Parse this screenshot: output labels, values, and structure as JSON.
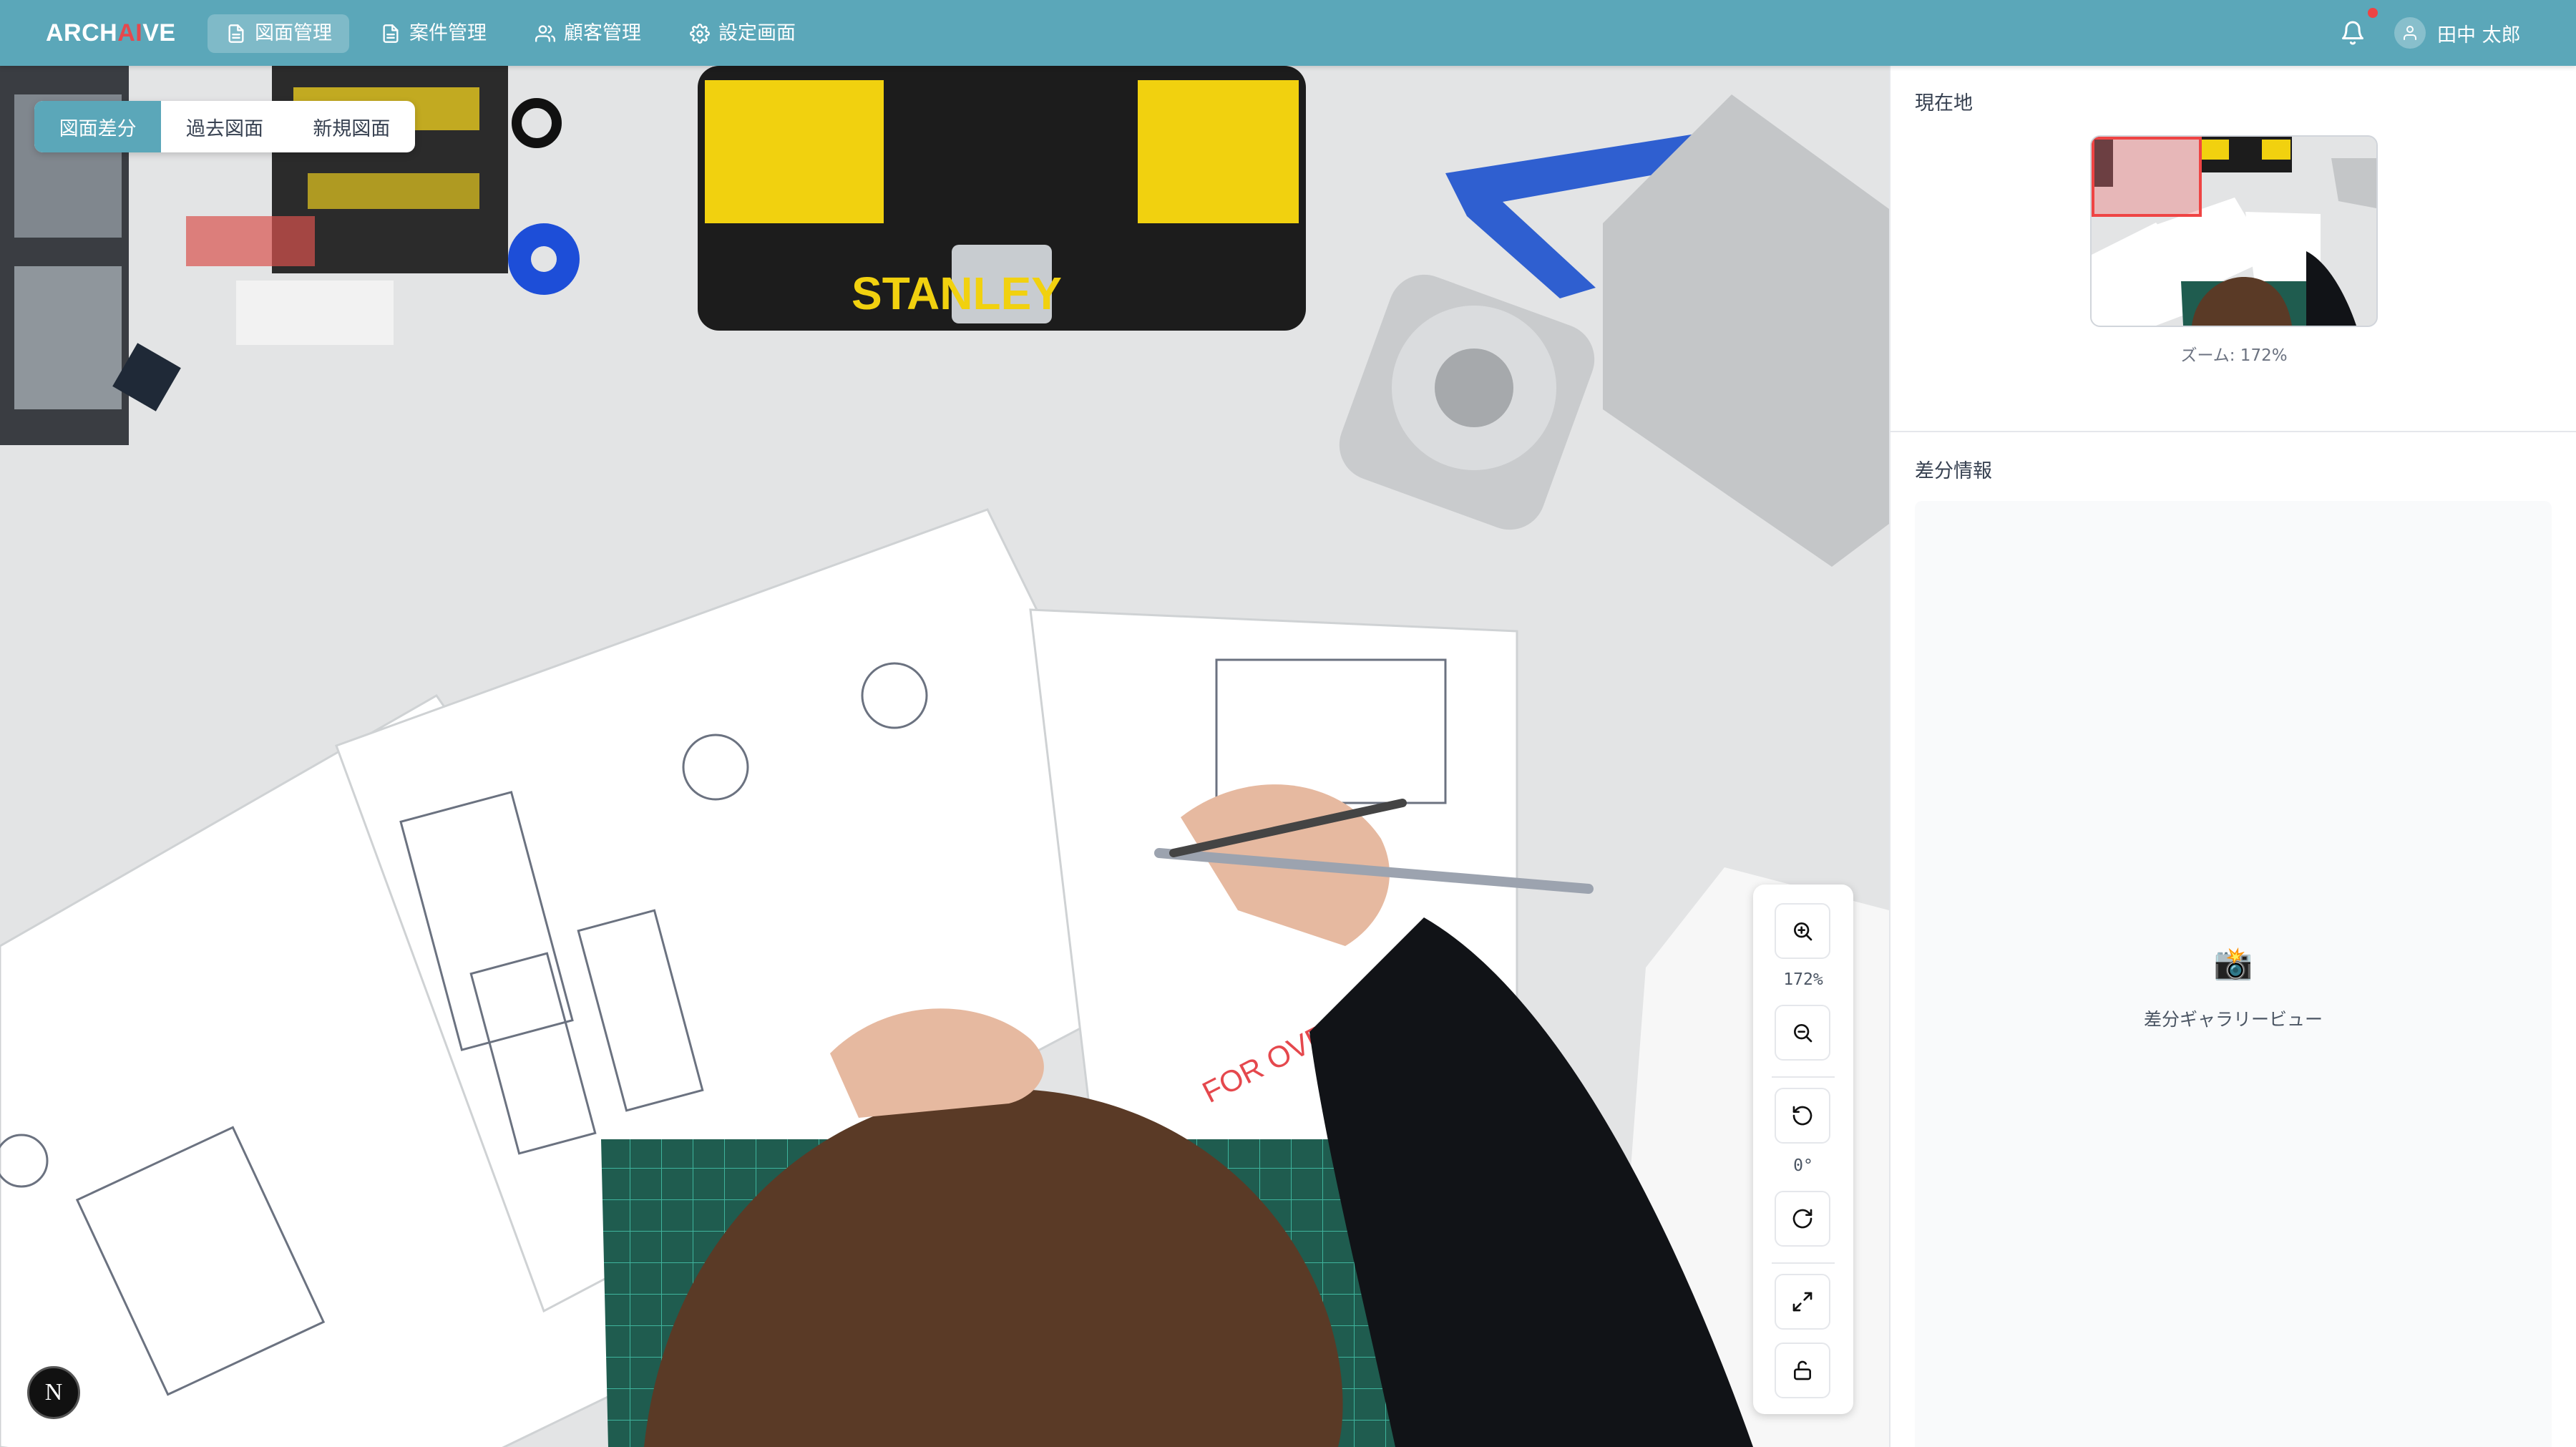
{
  "app": {
    "logo_prefix": "ARCH",
    "logo_ai": "AI",
    "logo_suffix": "VE",
    "brand_color": "#5ba7b9",
    "accent_color": "#e5484d"
  },
  "nav": {
    "items": [
      {
        "label": "図面管理",
        "icon": "document-icon",
        "active": true
      },
      {
        "label": "案件管理",
        "icon": "document-icon",
        "active": false
      },
      {
        "label": "顧客管理",
        "icon": "users-icon",
        "active": false
      },
      {
        "label": "設定画面",
        "icon": "gear-icon",
        "active": false
      }
    ],
    "notification_icon": "bell-icon",
    "user_name": "田中 太郎"
  },
  "viewer": {
    "tabs": [
      {
        "label": "図面差分",
        "active": true
      },
      {
        "label": "過去図面",
        "active": false
      },
      {
        "label": "新規図面",
        "active": false
      }
    ],
    "zoom_value": "172%",
    "rotation_value": "0°",
    "drawing_stamp": "FOR OVERVIEW",
    "box_brand": "STANLEY",
    "corner_badge": "N"
  },
  "panel": {
    "location_title": "現在地",
    "zoom_label": "ズーム: 172%",
    "diff_title": "差分情報",
    "gallery_icon": "📸",
    "gallery_label": "差分ギャラリービュー"
  }
}
